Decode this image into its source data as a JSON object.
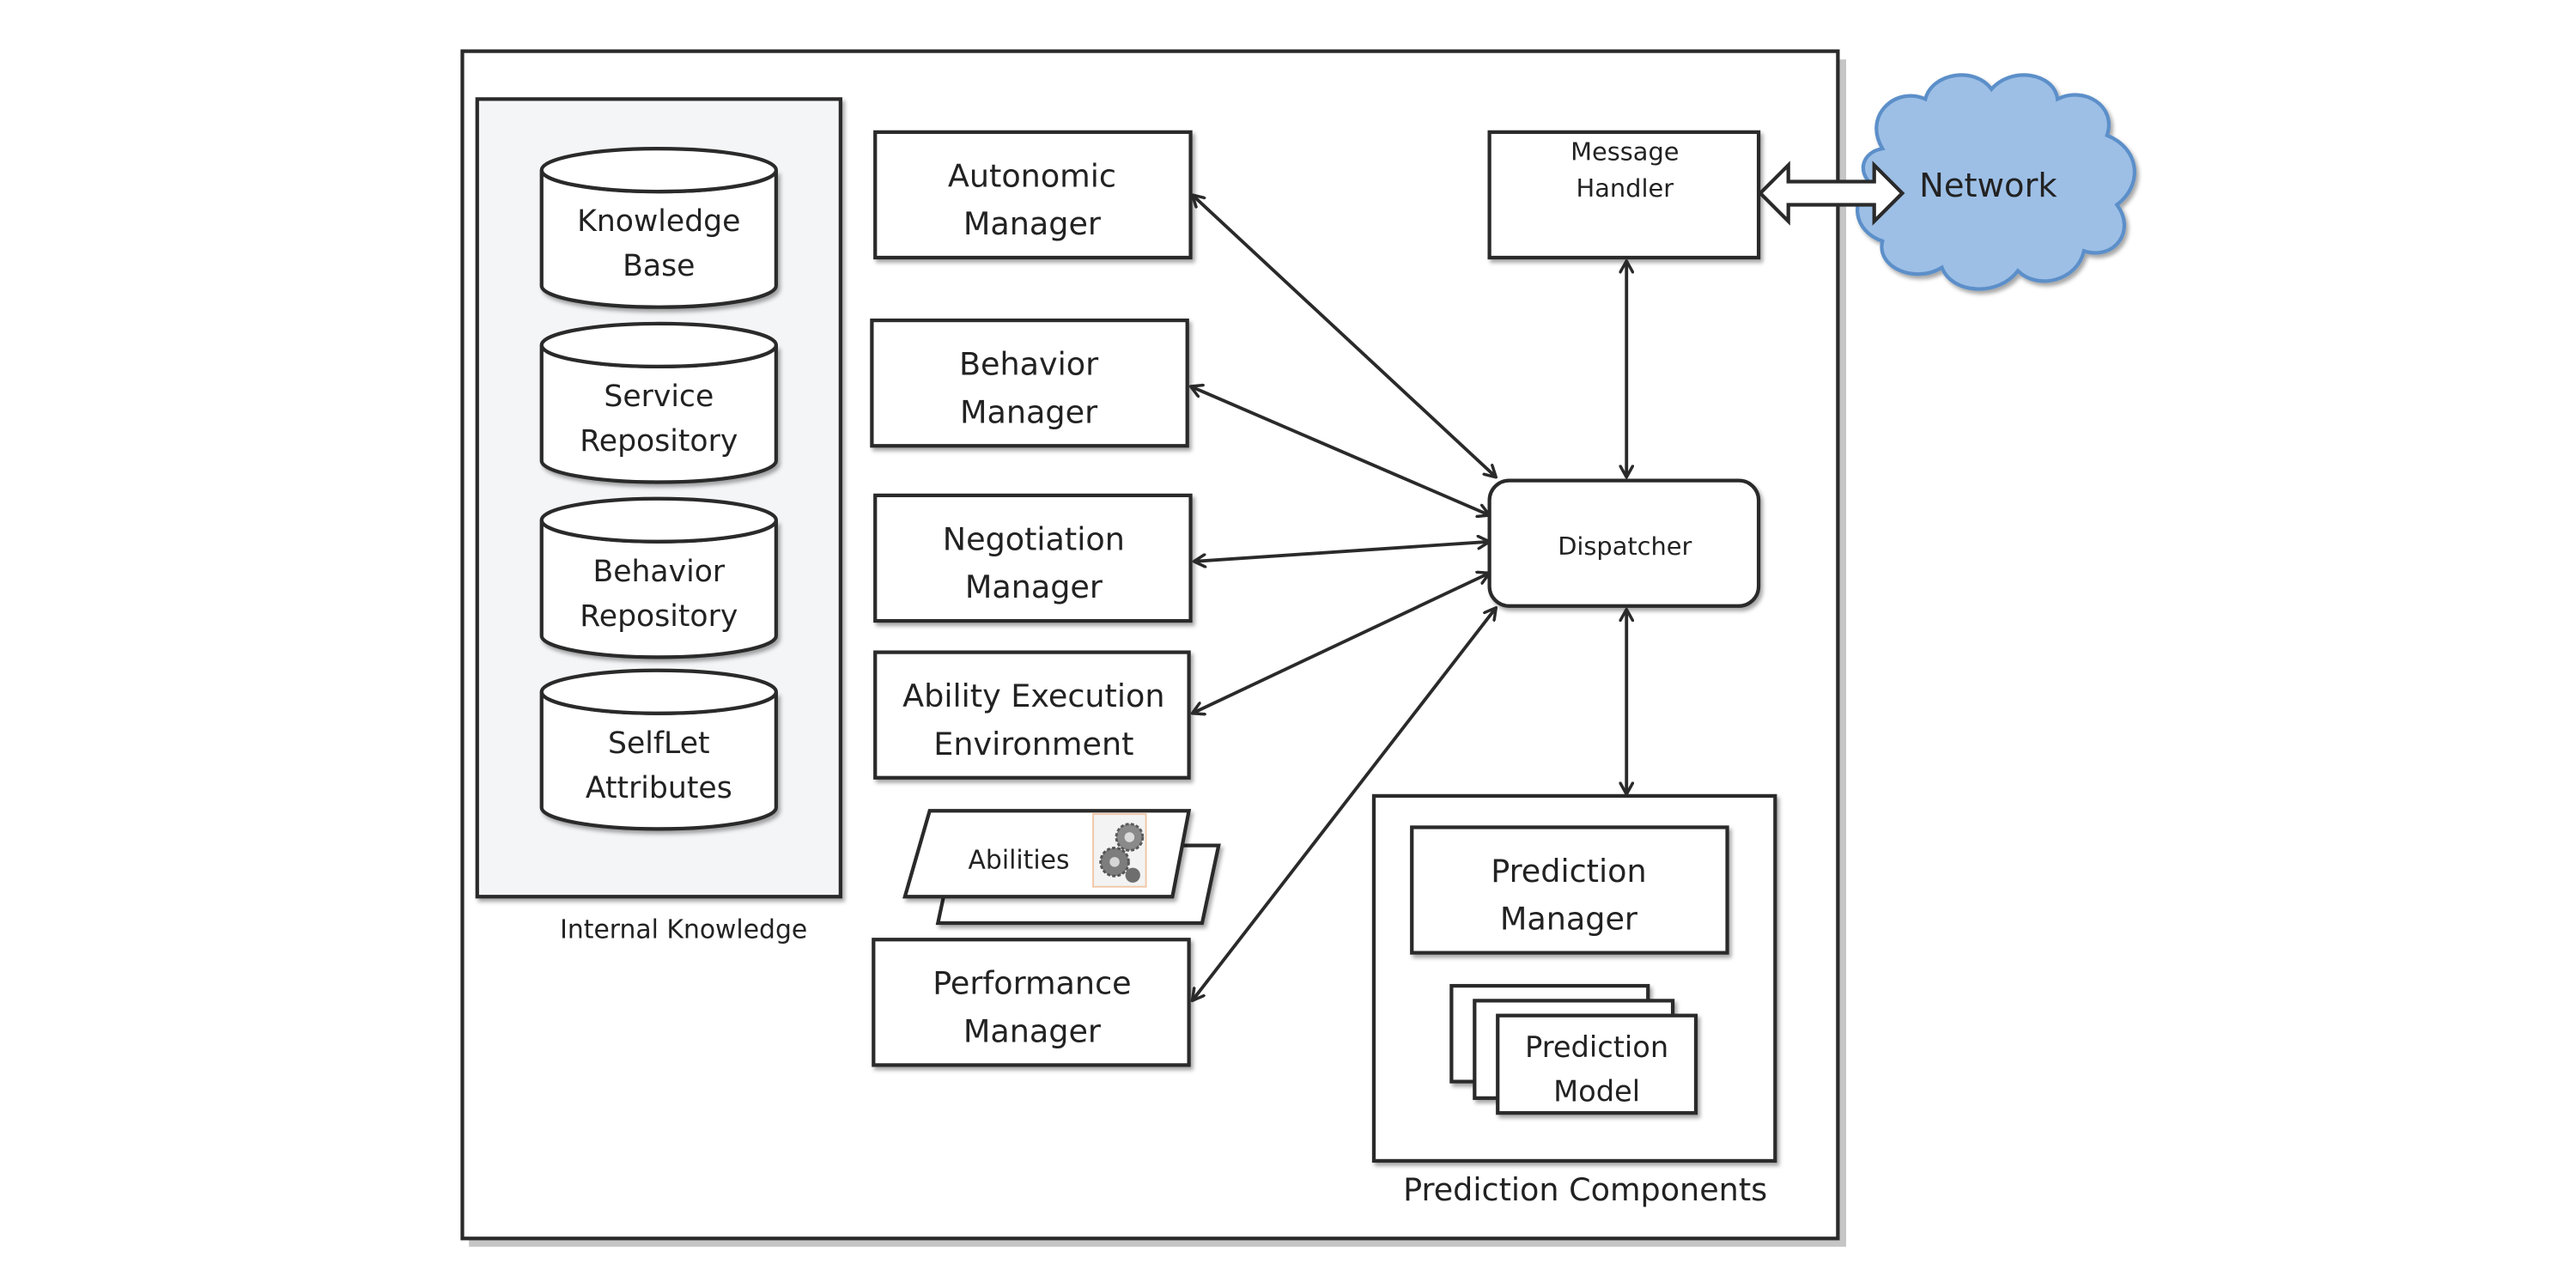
{
  "diagram": {
    "internal_knowledge": {
      "label": "Internal Knowledge",
      "stores": [
        {
          "line1": "Knowledge",
          "line2": "Base"
        },
        {
          "line1": "Service",
          "line2": "Repository"
        },
        {
          "line1": "Behavior",
          "line2": "Repository"
        },
        {
          "line1": "SelfLet",
          "line2": "Attributes"
        }
      ]
    },
    "managers": {
      "autonomic": {
        "line1": "Autonomic",
        "line2": "Manager"
      },
      "behavior": {
        "line1": "Behavior",
        "line2": "Manager"
      },
      "negotiation": {
        "line1": "Negotiation",
        "line2": "Manager"
      },
      "ability_execution": {
        "line1": "Ability Execution",
        "line2": "Environment"
      },
      "performance": {
        "line1": "Performance",
        "line2": "Manager"
      }
    },
    "abilities": {
      "label": "Abilities",
      "icon": "gears-icon"
    },
    "message_handler": {
      "line1": "Message",
      "line2": "Handler"
    },
    "network": {
      "label": "Network",
      "fill": "#9dbfe6",
      "stroke": "#5b8fc9"
    },
    "dispatcher": {
      "label": "Dispatcher"
    },
    "prediction": {
      "group_label": "Prediction Components",
      "manager": {
        "line1": "Prediction",
        "line2": "Manager"
      },
      "model": {
        "line1": "Prediction",
        "line2": "Model"
      }
    },
    "colors": {
      "stroke": "#2a2a2a",
      "panel_fill": "#f4f5f7",
      "shadow": "#bfbfbf"
    }
  }
}
